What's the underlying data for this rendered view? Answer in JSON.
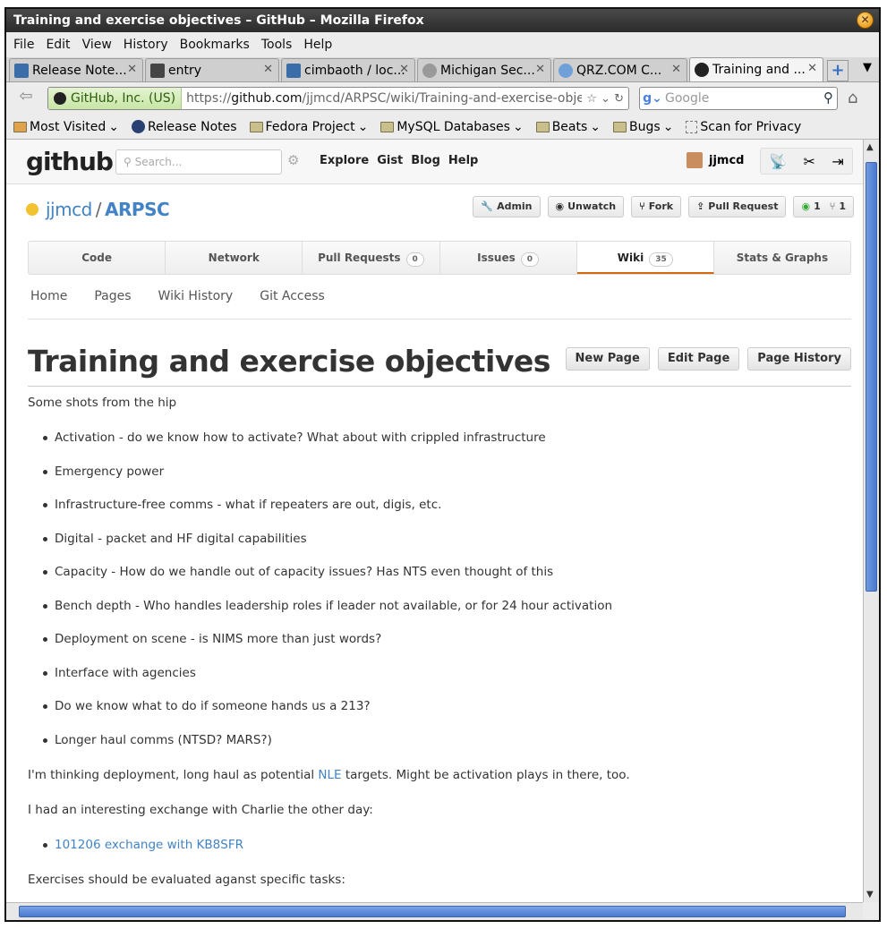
{
  "window": {
    "title": "Training and exercise objectives – GitHub – Mozilla Firefox"
  },
  "menu": [
    "File",
    "Edit",
    "View",
    "History",
    "Bookmarks",
    "Tools",
    "Help"
  ],
  "tabs": [
    {
      "label": "Release Note...",
      "icon": "release-notes-icon",
      "color": "#3b6ea8"
    },
    {
      "label": "entry",
      "icon": "entry-icon",
      "color": "#444444"
    },
    {
      "label": "cimbaoth / loc...",
      "icon": "cimbaoth-icon",
      "color": "#3b6ea8"
    },
    {
      "label": "Michigan Sec...",
      "icon": "michigan-icon",
      "color": "#888888"
    },
    {
      "label": "QRZ.COM C...",
      "icon": "globe-icon",
      "color": "#6fa1d8"
    },
    {
      "label": "Training and ...",
      "icon": "github-icon",
      "color": "#222222"
    }
  ],
  "urlbar": {
    "identity": "GitHub, Inc. (US)",
    "url_prefix": "https://",
    "url_domain": "github.com",
    "url_path": "/jjmcd/ARPSC/wiki/Training-and-exercise-objectiv"
  },
  "search": {
    "placeholder": "Google"
  },
  "bookmarks": [
    {
      "label": "Most Visited",
      "type": "folder"
    },
    {
      "label": "Release Notes",
      "type": "link"
    },
    {
      "label": "Fedora Project",
      "type": "folder"
    },
    {
      "label": "MySQL Databases",
      "type": "folder"
    },
    {
      "label": "Beats",
      "type": "folder"
    },
    {
      "label": "Bugs",
      "type": "folder"
    },
    {
      "label": "Scan for Privacy",
      "type": "link"
    }
  ],
  "github": {
    "logo": "github",
    "search_placeholder": "Search...",
    "nav": [
      "Explore",
      "Gist",
      "Blog",
      "Help"
    ],
    "username": "jjmcd",
    "repo_owner": "jjmcd",
    "repo_sep": "/",
    "repo_name": "ARPSC",
    "repo_buttons": [
      "Admin",
      "Unwatch",
      "Fork",
      "Pull Request"
    ],
    "watchers": "1",
    "forks": "1",
    "repo_tabs": [
      {
        "label": "Code",
        "count": ""
      },
      {
        "label": "Network",
        "count": ""
      },
      {
        "label": "Pull Requests",
        "count": "0"
      },
      {
        "label": "Issues",
        "count": "0"
      },
      {
        "label": "Wiki",
        "count": "35"
      },
      {
        "label": "Stats & Graphs",
        "count": ""
      }
    ],
    "wiki_nav": [
      "Home",
      "Pages",
      "Wiki History",
      "Git Access"
    ],
    "wiki_buttons": [
      "New Page",
      "Edit Page",
      "Page History"
    ],
    "accent": "#4183c4"
  },
  "page": {
    "title": "Training and exercise objectives",
    "intro": "Some shots from the hip",
    "items": [
      "Activation - do we know how to activate? What about with crippled infrastructure",
      "Emergency power",
      "Infrastructure-free comms - what if repeaters are out, digis, etc.",
      "Digital - packet and HF digital capabilities",
      "Capacity - How do we handle out of capacity issues? Has NTS even thought of this",
      "Bench depth - Who handles leadership roles if leader not available, or for 24 hour activation",
      "Deployment on scene - is NIMS more than just words?",
      "Interface with agencies",
      "Do we know what to do if someone hands us a 213?",
      "Longer haul comms (NTSD? MARS?)"
    ],
    "para1_before": "I'm thinking deployment, long haul as potential ",
    "para1_link": "NLE",
    "para1_after": " targets. Might be activation plays in there, too.",
    "para2": "I had an interesting exchange with Charlie the other day:",
    "exchange_link": "101206 exchange with KB8SFR",
    "para3": "Exercises should be evaluated aganst specific tasks:"
  }
}
